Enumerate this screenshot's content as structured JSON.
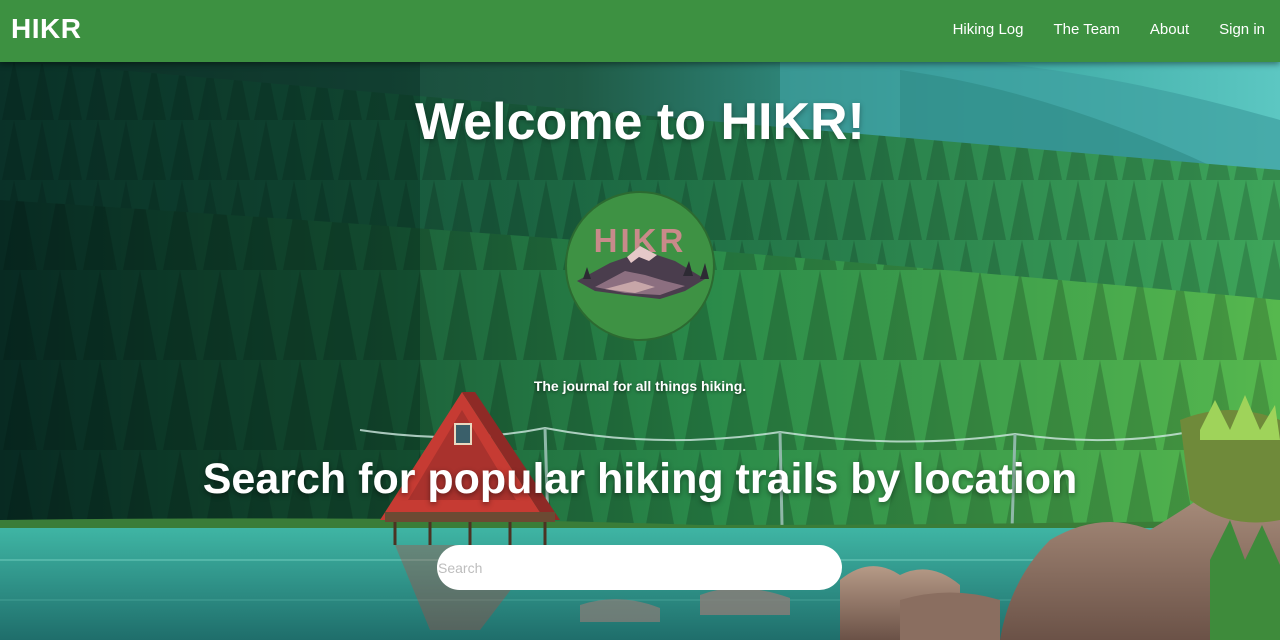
{
  "navbar": {
    "brand": "HIKR",
    "links": [
      {
        "label": "Hiking Log"
      },
      {
        "label": "The Team"
      },
      {
        "label": "About"
      },
      {
        "label": "Sign in"
      }
    ]
  },
  "hero": {
    "title": "Welcome to HIKR!",
    "logo_text": "HIKR",
    "tagline": "The journal for all things hiking.",
    "search_heading": "Search for popular hiking trails by location",
    "search_placeholder": "Search"
  },
  "colors": {
    "navbar_bg": "#3d9141",
    "logo_circle": "#3e9244",
    "logo_text": "#c98a8a",
    "cabin_roof": "#c63b33",
    "lake": "#2e9d93"
  },
  "icons": {
    "logo": "mountain-logo",
    "background": "forest-lake-cabin-illustration"
  }
}
